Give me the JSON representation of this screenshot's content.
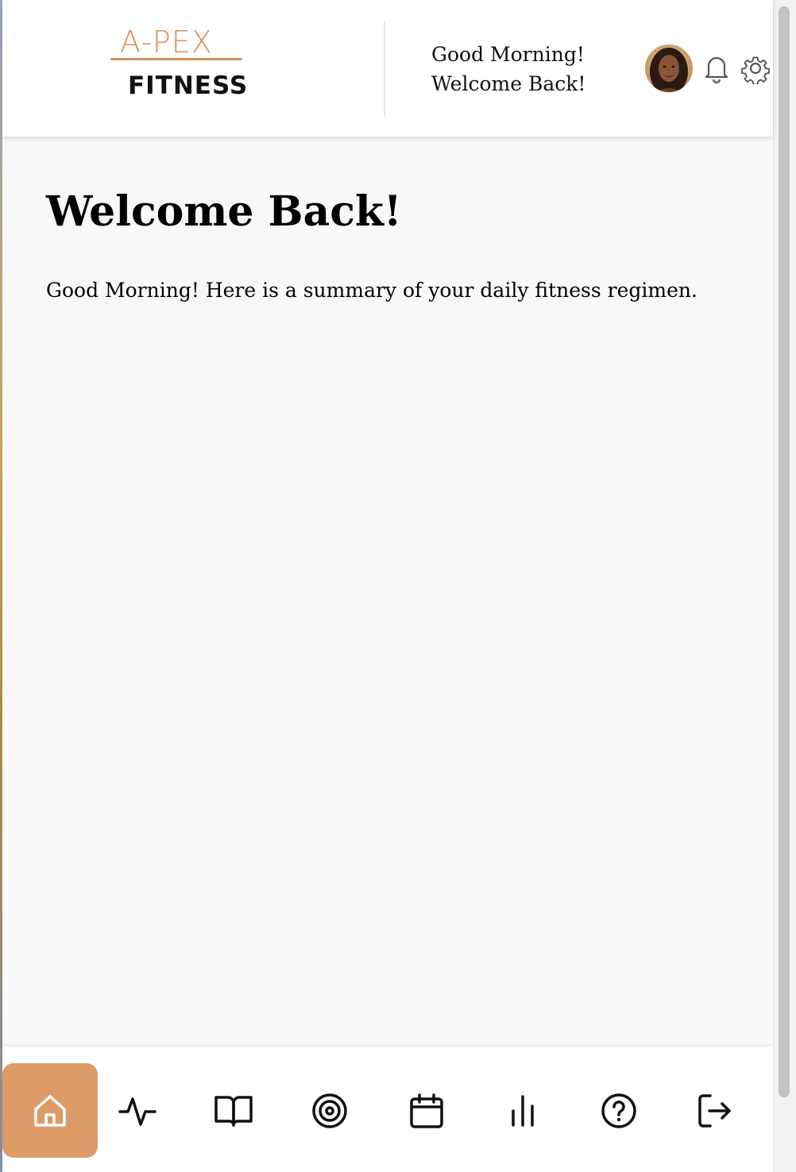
{
  "brand": {
    "logo_top": "A-PEX",
    "logo_bottom": "FITNESS",
    "accent_color": "#dd9b67"
  },
  "header": {
    "greeting_line1": "Good Morning!",
    "greeting_line2": "Welcome Back!",
    "icons": [
      "avatar",
      "bell-icon",
      "gear-icon"
    ]
  },
  "main": {
    "title": "Welcome Back!",
    "subtitle": "Good Morning! Here is a summary of your daily fitness regimen."
  },
  "bottom_nav": {
    "items": [
      {
        "icon": "home-icon",
        "active": true
      },
      {
        "icon": "activity-icon",
        "active": false
      },
      {
        "icon": "book-icon",
        "active": false
      },
      {
        "icon": "target-icon",
        "active": false
      },
      {
        "icon": "calendar-icon",
        "active": false
      },
      {
        "icon": "bar-chart-icon",
        "active": false
      },
      {
        "icon": "help-icon",
        "active": false
      },
      {
        "icon": "logout-icon",
        "active": false
      }
    ]
  }
}
